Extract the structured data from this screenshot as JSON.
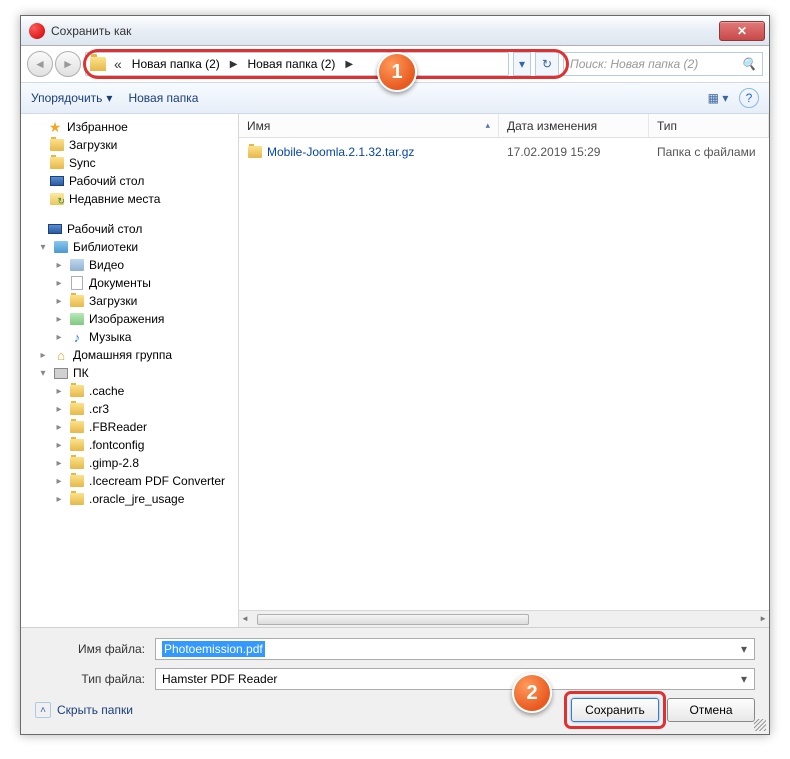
{
  "window": {
    "title": "Сохранить как"
  },
  "breadcrumb": {
    "seg1": "Новая папка (2)",
    "seg2": "Новая папка (2)"
  },
  "search": {
    "placeholder": "Поиск: Новая папка (2)"
  },
  "toolbar": {
    "organize": "Упорядочить",
    "newfolder": "Новая папка"
  },
  "sidebar": {
    "favorites": "Избранное",
    "downloads": "Загрузки",
    "sync": "Sync",
    "desktop": "Рабочий стол",
    "recent": "Недавние места",
    "desktop2": "Рабочий стол",
    "libraries": "Библиотеки",
    "video": "Видео",
    "documents": "Документы",
    "downloads2": "Загрузки",
    "images": "Изображения",
    "music": "Музыка",
    "homegroup": "Домашняя группа",
    "pc": "ПК",
    "cache": ".cache",
    "cr3": ".cr3",
    "fbreader": ".FBReader",
    "fontconfig": ".fontconfig",
    "gimp": ".gimp-2.8",
    "icecream": ".Icecream PDF Converter",
    "oracle": ".oracle_jre_usage"
  },
  "columns": {
    "name": "Имя",
    "date": "Дата изменения",
    "type": "Тип"
  },
  "files": [
    {
      "name": "Mobile-Joomla.2.1.32.tar.gz",
      "date": "17.02.2019 15:29",
      "type": "Папка с файлами"
    }
  ],
  "form": {
    "filename_label": "Имя файла:",
    "filename_value": "Photoemission.pdf",
    "filetype_label": "Тип файла:",
    "filetype_value": "Hamster PDF Reader",
    "hide_folders": "Скрыть папки",
    "save": "Сохранить",
    "cancel": "Отмена"
  },
  "callouts": {
    "c1": "1",
    "c2": "2"
  }
}
